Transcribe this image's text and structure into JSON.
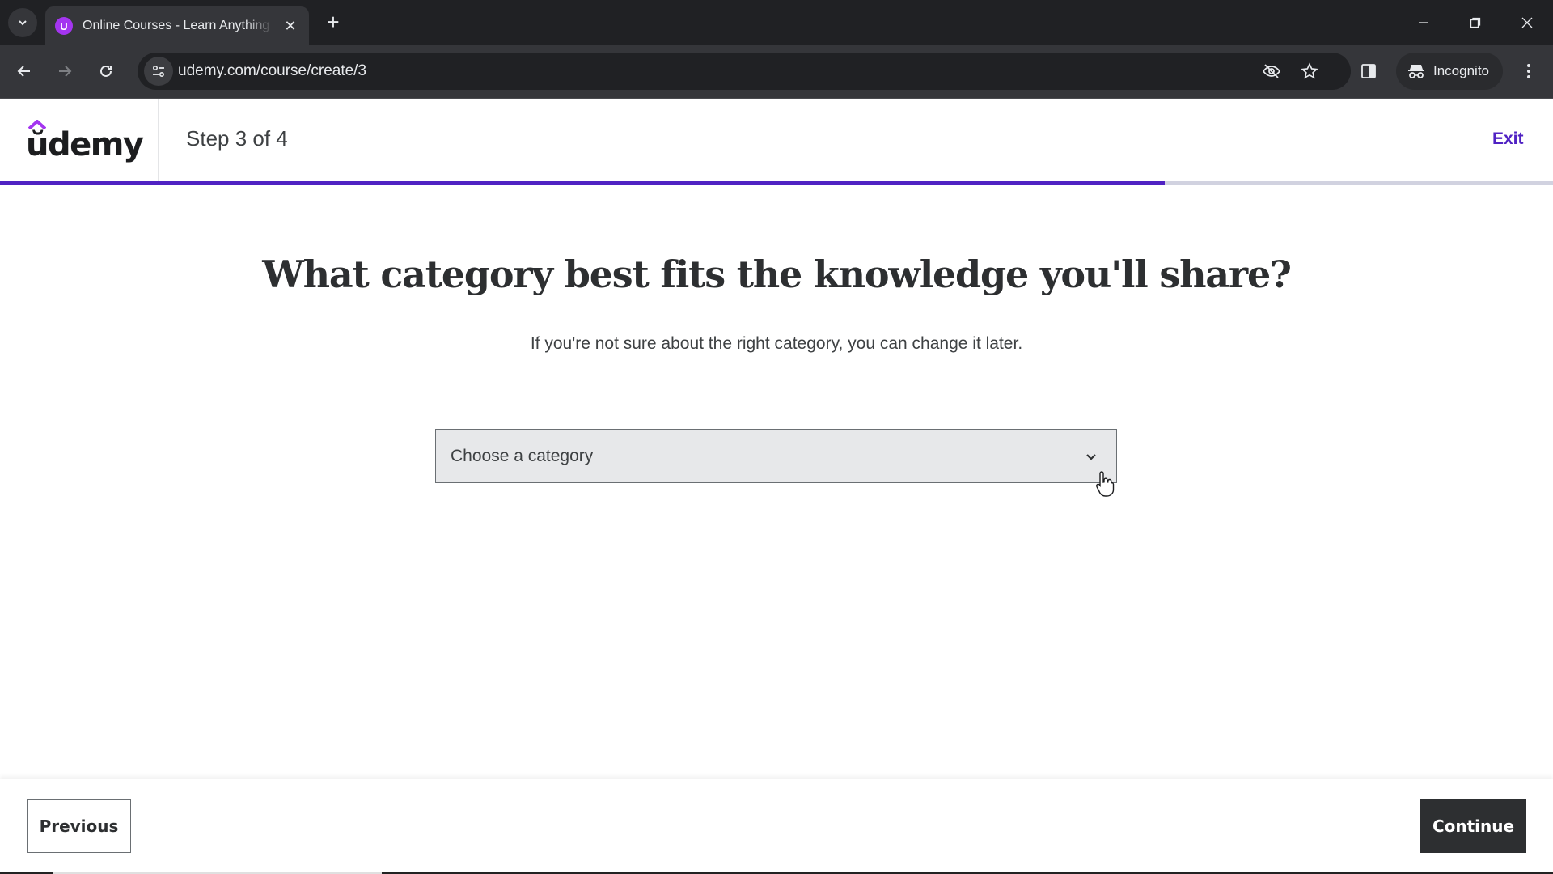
{
  "browser": {
    "tab_title": "Online Courses - Learn Anything",
    "tab_favicon_letter": "U",
    "url": "udemy.com/course/create/3",
    "incognito_label": "Incognito",
    "icons": {
      "tab_list": "chevron-down-icon",
      "tab_close": "close-icon",
      "new_tab": "plus-icon",
      "back": "arrow-left-icon",
      "forward": "arrow-right-icon",
      "reload": "reload-icon",
      "site_info": "tune-icon",
      "tracking": "eye-off-icon",
      "bookmark": "star-icon",
      "side_panel": "side-panel-icon",
      "incognito": "incognito-icon",
      "menu": "more-vert-icon"
    },
    "tab_close_glyph": "✕",
    "new_tab_glyph": "+"
  },
  "header": {
    "logo_text": "ŭdemy",
    "step_label": "Step 3 of 4",
    "exit_label": "Exit",
    "progress_fraction": 0.75
  },
  "main": {
    "heading": "What category best fits the knowledge you'll share?",
    "subtitle": "If you're not sure about the right category, you can change it later.",
    "category_select": {
      "placeholder": "Choose a category",
      "selected_value": "Choose a category"
    }
  },
  "footer": {
    "previous_label": "Previous",
    "continue_label": "Continue"
  },
  "colors": {
    "brand_purple": "#5022c3",
    "logo_accent": "#a435f0",
    "dark_button": "#2d2f31"
  }
}
